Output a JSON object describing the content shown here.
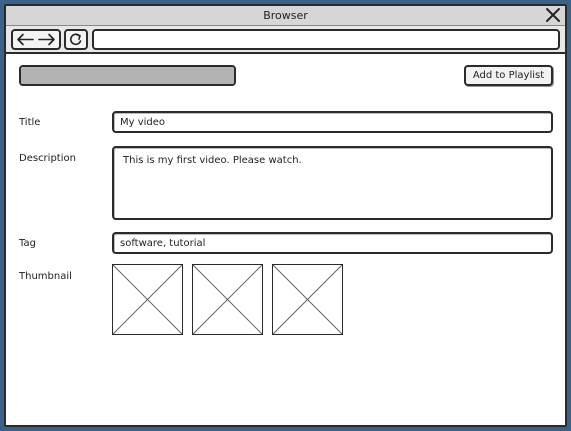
{
  "window": {
    "title": "Browser"
  },
  "icons": {
    "close": "close-icon",
    "back": "arrow-left-icon",
    "forward": "arrow-right-icon",
    "refresh": "refresh-icon",
    "thumbnail_placeholder": "image-placeholder-icon"
  },
  "toolbar": {
    "address_value": ""
  },
  "upload": {
    "progress": 1.0
  },
  "actions": {
    "add_to_playlist": "Add to Playlist"
  },
  "form": {
    "title_label": "Title",
    "title_value": "My video",
    "description_label": "Description",
    "description_value": "This is my first video. Please watch.",
    "tag_label": "Tag",
    "tag_value": "software, tutorial",
    "thumbnail_label": "Thumbnail",
    "thumbnails": [
      "",
      "",
      ""
    ]
  },
  "colors": {
    "background": "#3d6289",
    "border": "#2b2b2b",
    "progress_fill": "#b3b3b3"
  }
}
